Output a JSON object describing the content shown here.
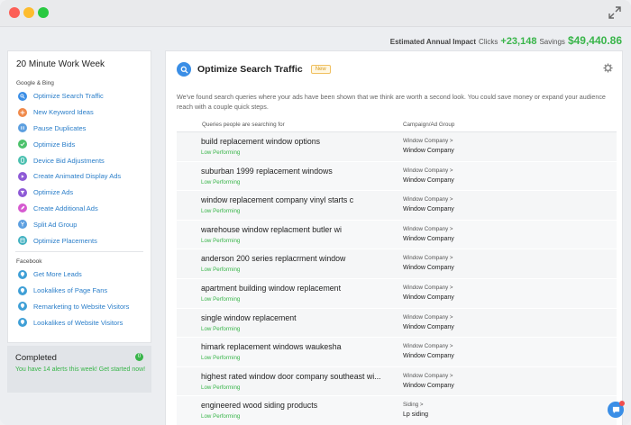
{
  "summary": {
    "label": "Estimated Annual Impact",
    "clicks_label": "Clicks",
    "clicks_value": "+23,148",
    "savings_label": "Savings",
    "savings_value": "$49,440.86"
  },
  "sidebar": {
    "title": "20 Minute Work Week",
    "google_section": "Google & Bing",
    "google_items": [
      {
        "label": "Optimize Search Traffic",
        "icon": "search-icon",
        "color": "#3a8ee6"
      },
      {
        "label": "New Keyword Ideas",
        "icon": "plus-icon",
        "color": "#f08a4b"
      },
      {
        "label": "Pause Duplicates",
        "icon": "pause-icon",
        "color": "#5c9fe0"
      },
      {
        "label": "Optimize Bids",
        "icon": "check-icon",
        "color": "#4cc26b"
      },
      {
        "label": "Device Bid Adjustments",
        "icon": "device-icon",
        "color": "#4bc0b0"
      },
      {
        "label": "Create Animated Display Ads",
        "icon": "animated-icon",
        "color": "#8e5ad6"
      },
      {
        "label": "Optimize Ads",
        "icon": "filter-icon",
        "color": "#8e5ad6"
      },
      {
        "label": "Create Additional Ads",
        "icon": "pencil-icon",
        "color": "#d65ad0"
      },
      {
        "label": "Split Ad Group",
        "icon": "split-icon",
        "color": "#5c9fe0"
      },
      {
        "label": "Optimize Placements",
        "icon": "placements-icon",
        "color": "#3fb0c0"
      }
    ],
    "facebook_section": "Facebook",
    "facebook_items": [
      {
        "label": "Get More Leads",
        "icon": "leads-icon",
        "color": "#3f9fd6"
      },
      {
        "label": "Lookalikes of Page Fans",
        "icon": "lookalike-icon",
        "color": "#3f9fd6"
      },
      {
        "label": "Remarketing to Website Visitors",
        "icon": "remarketing-icon",
        "color": "#3f9fd6"
      },
      {
        "label": "Lookalikes of Website Visitors",
        "icon": "lookalike-visitors-icon",
        "color": "#3f9fd6"
      }
    ]
  },
  "completed": {
    "title": "Completed",
    "badge": "0",
    "message": "You have 14 alerts this week! Get started now!"
  },
  "main": {
    "title": "Optimize Search Traffic",
    "badge": "New",
    "description": "We've found search queries where your ads have been shown that we think are worth a second look. You could save money or expand your audience reach with a couple quick steps.",
    "col_queries": "Queries people are searching for",
    "col_campaign": "Campaign/Ad Group",
    "rows": [
      {
        "query": "build replacement window options",
        "status": "Low Performing",
        "campaign": "Window Company >",
        "group": "Window Company"
      },
      {
        "query": "suburban 1999 replacement windows",
        "status": "Low Performing",
        "campaign": "Window Company >",
        "group": "Window Company"
      },
      {
        "query": "window replacement company vinyl starts c",
        "status": "Low Performing",
        "campaign": "Window Company >",
        "group": "Window Company"
      },
      {
        "query": "warehouse window replacment butler wi",
        "status": "Low Performing",
        "campaign": "Window Company >",
        "group": "Window Company"
      },
      {
        "query": "anderson 200 series replacrment window",
        "status": "Low Performing",
        "campaign": "Window Company >",
        "group": "Window Company"
      },
      {
        "query": "apartment building window replacement",
        "status": "Low Performing",
        "campaign": "Window Company >",
        "group": "Window Company"
      },
      {
        "query": "single window replacement",
        "status": "Low Performing",
        "campaign": "Window Company >",
        "group": "Window Company"
      },
      {
        "query": "himark replacement windows waukesha",
        "status": "Low Performing",
        "campaign": "Window Company >",
        "group": "Window Company"
      },
      {
        "query": "highest rated window door company southeast wi...",
        "status": "Low Performing",
        "campaign": "Window Company >",
        "group": "Window Company"
      },
      {
        "query": "engineered wood siding products",
        "status": "Low Performing",
        "campaign": "Siding >",
        "group": "Lp siding"
      }
    ]
  }
}
